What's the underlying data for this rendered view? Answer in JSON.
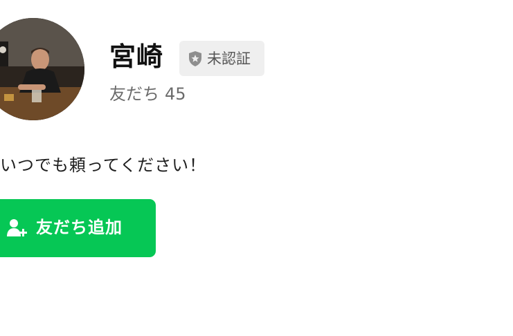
{
  "profile": {
    "name": "宮崎",
    "badge_label": "未認証",
    "friends_label": "友だち",
    "friends_count": "45",
    "status_message": "いつでも頼ってください！"
  },
  "actions": {
    "add_friend_label": "友だち追加"
  },
  "colors": {
    "accent_green": "#06c755",
    "badge_bg": "#efefef",
    "muted_text": "#6b6b6b"
  },
  "icons": {
    "badge": "shield-icon",
    "add_friend": "add-person-icon"
  }
}
